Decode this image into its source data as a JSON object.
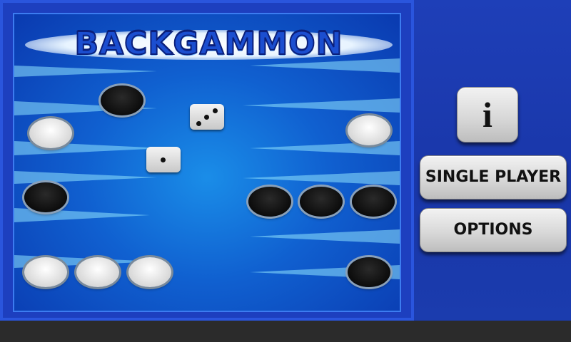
{
  "game": {
    "title": "BACKGAMMON",
    "dice": [
      {
        "id": "die-three",
        "value": 3
      },
      {
        "id": "die-one",
        "value": 1
      }
    ],
    "checkers": [
      {
        "color": "black",
        "slot": "top-left-1"
      },
      {
        "color": "white",
        "slot": "left-2"
      },
      {
        "color": "black",
        "slot": "left-4"
      },
      {
        "color": "white",
        "slot": "bottom-left-a"
      },
      {
        "color": "white",
        "slot": "bottom-left-b"
      },
      {
        "color": "white",
        "slot": "bottom-left-c"
      },
      {
        "color": "white",
        "slot": "right-2"
      },
      {
        "color": "black",
        "slot": "right-4-a"
      },
      {
        "color": "black",
        "slot": "right-4-b"
      },
      {
        "color": "black",
        "slot": "right-4-c"
      },
      {
        "color": "black",
        "slot": "right-6"
      }
    ]
  },
  "menu": {
    "info_label": "i",
    "single_player_label": "SINGLE PLAYER",
    "options_label": "OPTIONS"
  },
  "colors": {
    "board_blue": "#1060d0",
    "frame_blue": "#1d3fbf",
    "button_gray": "#d6d6d6",
    "title_blue": "#1b4ed0"
  }
}
